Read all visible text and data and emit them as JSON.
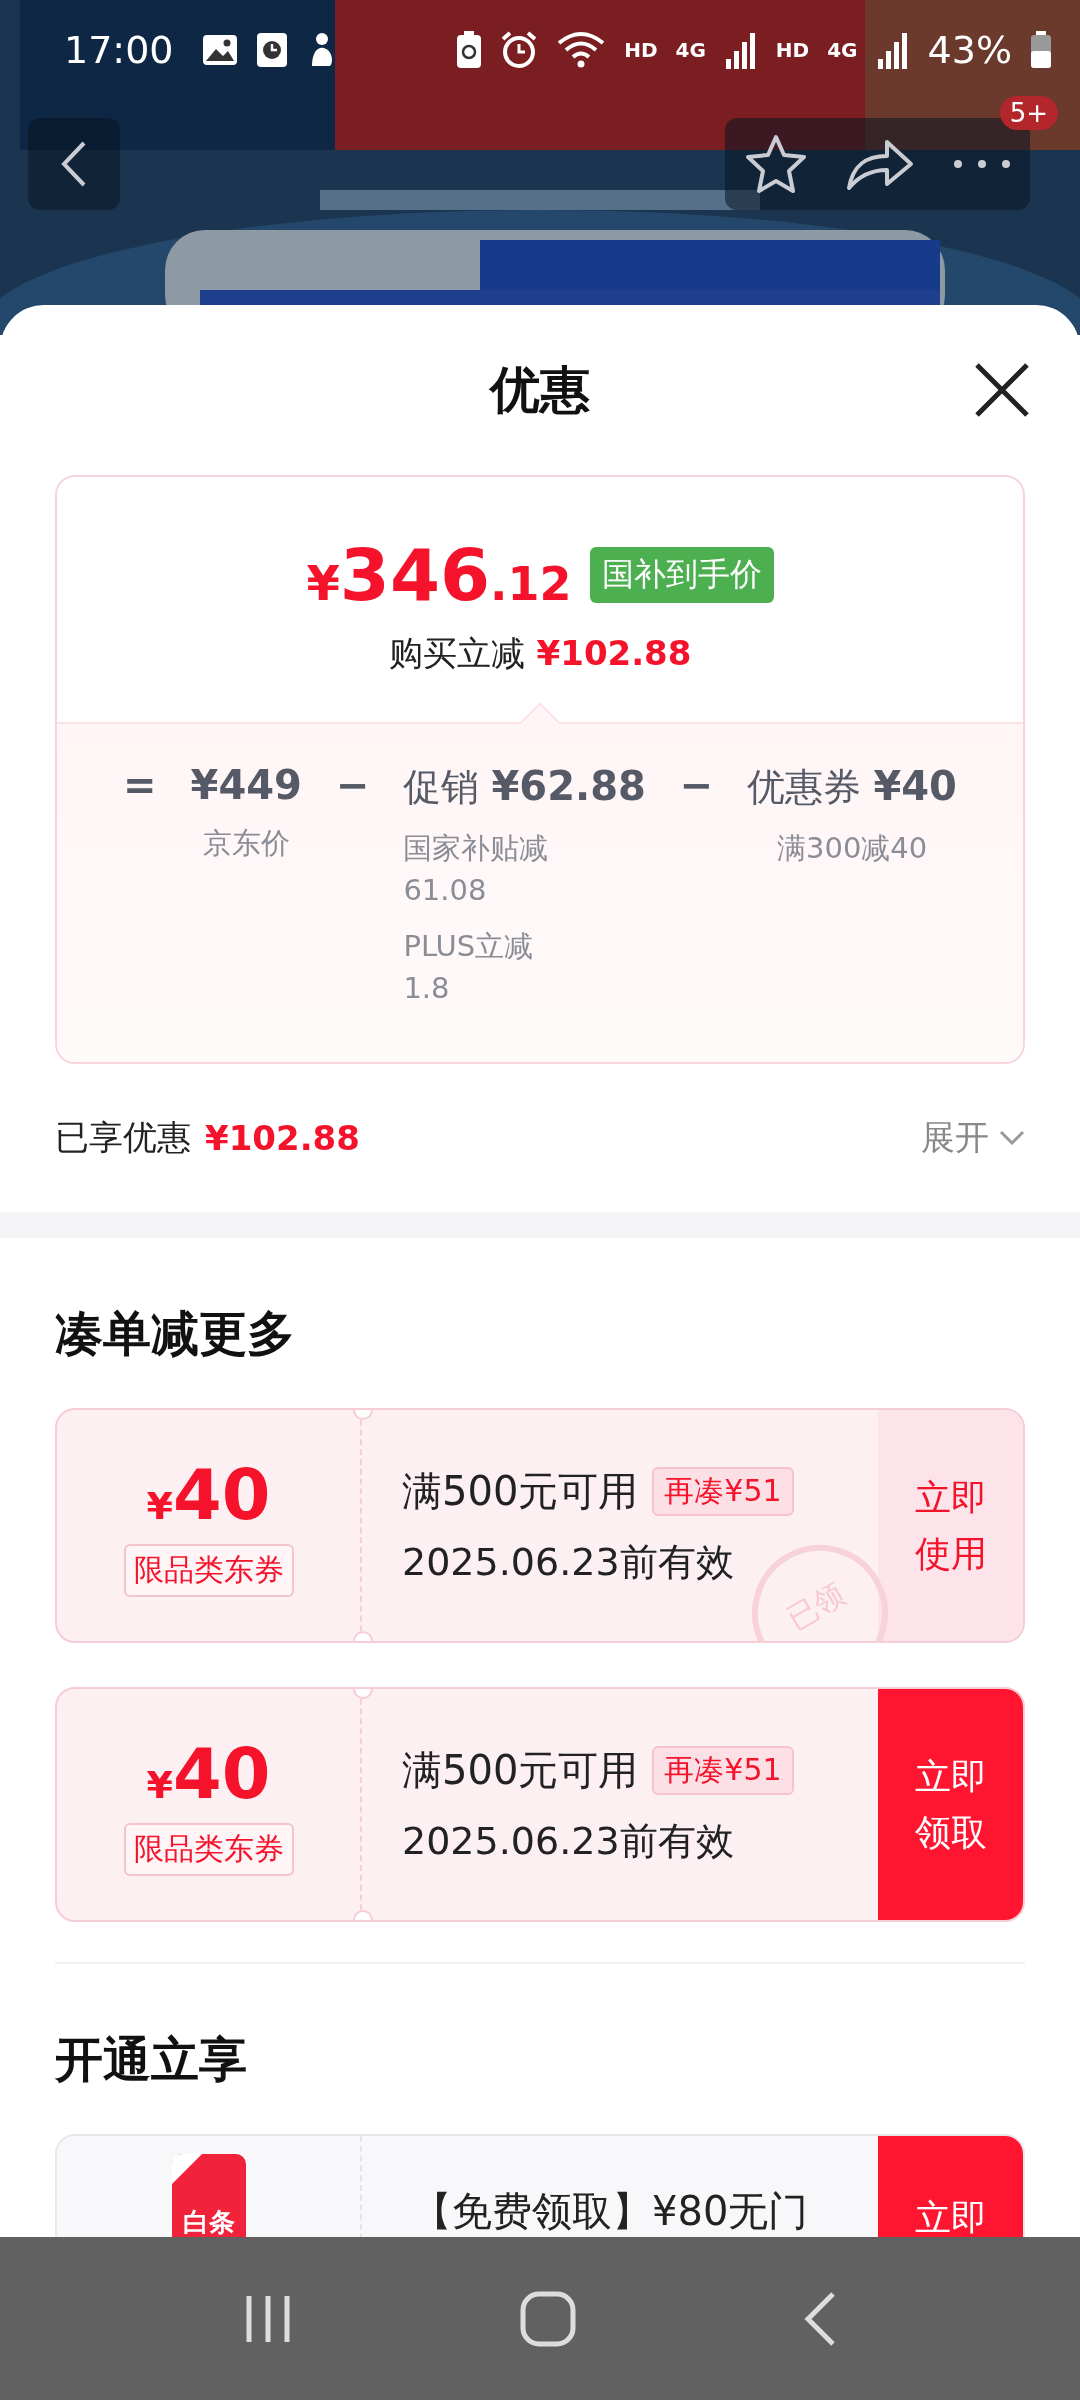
{
  "status_bar": {
    "time": "17:00",
    "networks": [
      {
        "hd": "HD",
        "gen": "4G"
      },
      {
        "hd": "HD",
        "gen": "4G"
      }
    ],
    "battery": "43%"
  },
  "top_bar": {
    "badge": "5+"
  },
  "sheet": {
    "title": "优惠"
  },
  "price_card": {
    "currency": "¥",
    "price_int": "346",
    "price_dec": ".12",
    "price_tag": "国补到手价",
    "reduction_label": "购买立减",
    "reduction_value": "¥102.88",
    "terms": [
      {
        "op": "=",
        "value": "¥449",
        "notes": [
          [
            "京东价"
          ]
        ]
      },
      {
        "op": "−",
        "label": "促销",
        "value": "¥62.88",
        "notes": [
          [
            "国家补贴减",
            "61.08"
          ],
          [
            "PLUS立减",
            "1.8"
          ]
        ]
      },
      {
        "op": "−",
        "label": "优惠券",
        "value": "¥40",
        "notes": [
          [
            "满300减40"
          ]
        ]
      }
    ]
  },
  "savings": {
    "label": "已享优惠",
    "value": "¥102.88",
    "toggle": "展开",
    "expanded": false
  },
  "sections": [
    {
      "title": "凑单减更多",
      "coupons": [
        {
          "kind": "amount",
          "currency": "¥",
          "amount": "40",
          "tag": "限品类东券",
          "condition": "满500元可用",
          "extra": "再凑¥51",
          "validity": "2025.06.23前有效",
          "action": "立即使用",
          "claimed": true,
          "stamp": "已领"
        },
        {
          "kind": "amount",
          "currency": "¥",
          "amount": "40",
          "tag": "限品类东券",
          "condition": "满500元可用",
          "extra": "再凑¥51",
          "validity": "2025.06.23前有效",
          "action": "立即领取",
          "claimed": false
        }
      ]
    },
    {
      "title": "开通立享",
      "coupons": [
        {
          "kind": "credit",
          "icon_label": "白条",
          "condition": "【免费领取】¥80无门",
          "action": "立即",
          "claimed": false
        }
      ]
    }
  ]
}
